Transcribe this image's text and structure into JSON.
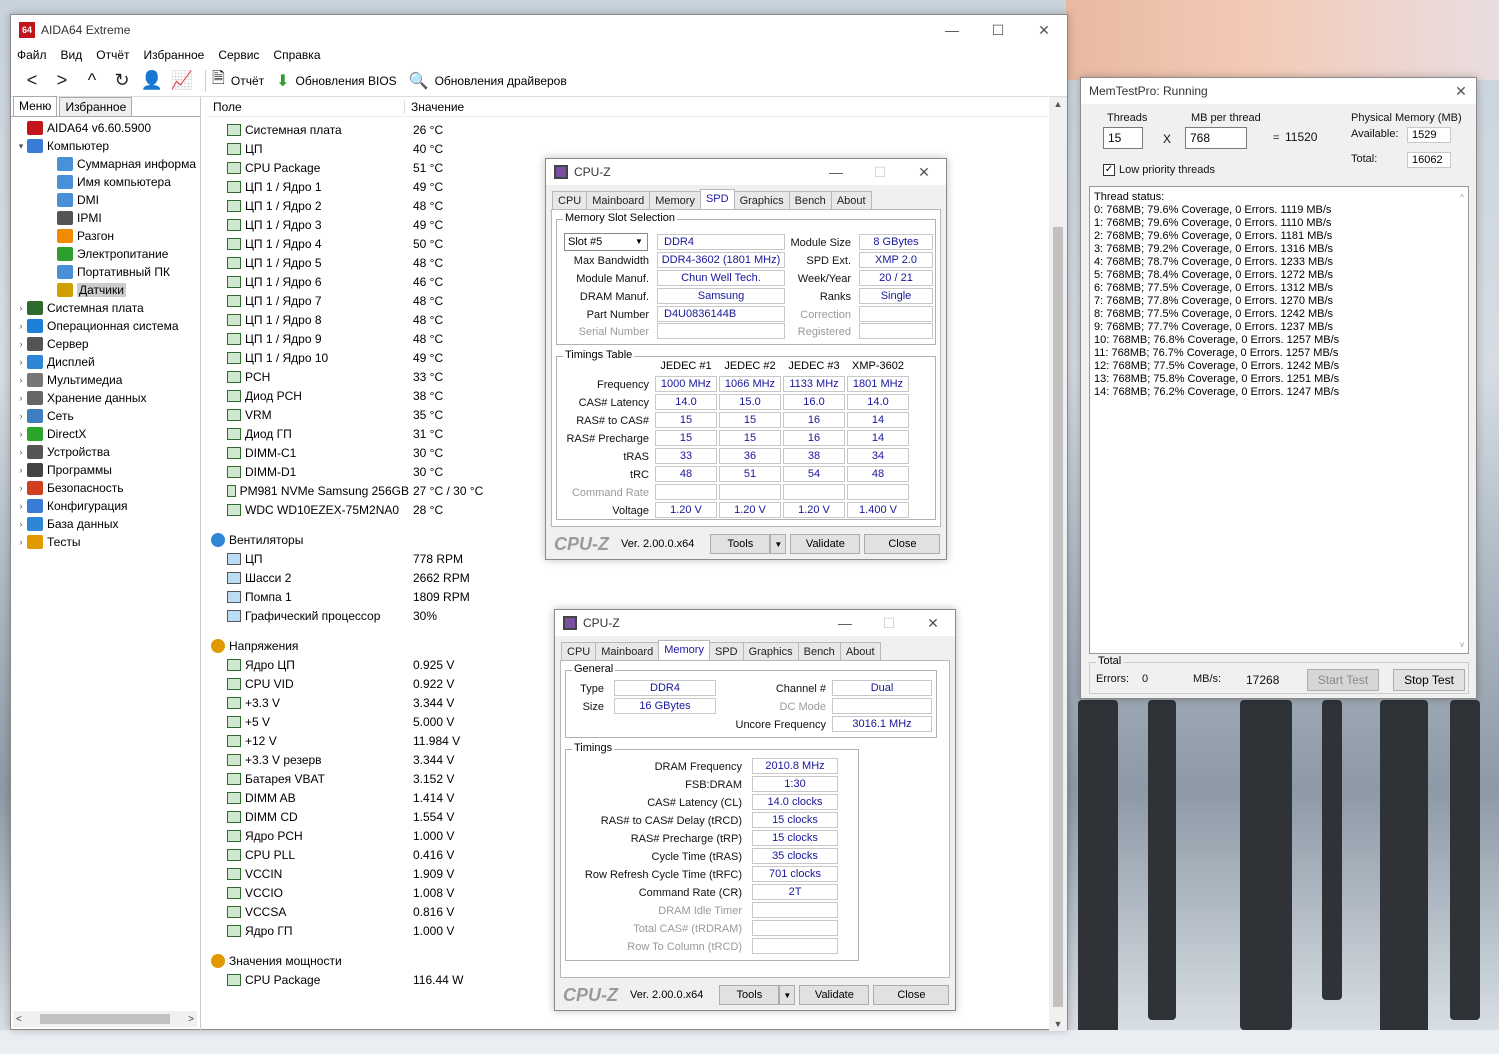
{
  "aida": {
    "title": "AIDA64 Extreme",
    "logo": "64",
    "menu": [
      "Файл",
      "Вид",
      "Отчёт",
      "Избранное",
      "Сервис",
      "Справка"
    ],
    "toolbar": {
      "report": "Отчёт",
      "bios": "Обновления BIOS",
      "drivers": "Обновления драйверов"
    },
    "tabs": [
      "Меню",
      "Избранное"
    ],
    "tree": [
      {
        "label": "AIDA64 v6.60.5900",
        "level": 0,
        "color": "#c0151b"
      },
      {
        "label": "Компьютер",
        "level": 0,
        "color": "#3a7bd5",
        "expanded": true
      },
      {
        "label": "Суммарная информа",
        "level": 1,
        "color": "#4a90d9"
      },
      {
        "label": "Имя компьютера",
        "level": 1,
        "color": "#4a90d9"
      },
      {
        "label": "DMI",
        "level": 1,
        "color": "#4a90d9"
      },
      {
        "label": "IPMI",
        "level": 1,
        "color": "#555555"
      },
      {
        "label": "Разгон",
        "level": 1,
        "color": "#f08a00"
      },
      {
        "label": "Электропитание",
        "level": 1,
        "color": "#2e9e2e"
      },
      {
        "label": "Портативный ПК",
        "level": 1,
        "color": "#4a90d9"
      },
      {
        "label": "Датчики",
        "level": 1,
        "color": "#d0a000",
        "selected": true
      },
      {
        "label": "Системная плата",
        "level": 0,
        "color": "#2f6b2f"
      },
      {
        "label": "Операционная система",
        "level": 0,
        "color": "#1e7fd6"
      },
      {
        "label": "Сервер",
        "level": 0,
        "color": "#555555"
      },
      {
        "label": "Дисплей",
        "level": 0,
        "color": "#2f86d6"
      },
      {
        "label": "Мультимедиа",
        "level": 0,
        "color": "#777777"
      },
      {
        "label": "Хранение данных",
        "level": 0,
        "color": "#666666"
      },
      {
        "label": "Сеть",
        "level": 0,
        "color": "#3f7fbf"
      },
      {
        "label": "DirectX",
        "level": 0,
        "color": "#2aa52a"
      },
      {
        "label": "Устройства",
        "level": 0,
        "color": "#555555"
      },
      {
        "label": "Программы",
        "level": 0,
        "color": "#444444"
      },
      {
        "label": "Безопасность",
        "level": 0,
        "color": "#d04020"
      },
      {
        "label": "Конфигурация",
        "level": 0,
        "color": "#3a7bd5"
      },
      {
        "label": "База данных",
        "level": 0,
        "color": "#2f86d6"
      },
      {
        "label": "Тесты",
        "level": 0,
        "color": "#e09a00"
      }
    ],
    "columns": {
      "field": "Поле",
      "value": "Значение"
    },
    "temps": [
      {
        "name": "Системная плата",
        "value": "26 °C"
      },
      {
        "name": "ЦП",
        "value": "40 °C"
      },
      {
        "name": "CPU Package",
        "value": "51 °C"
      },
      {
        "name": "ЦП 1 / Ядро 1",
        "value": "49 °C"
      },
      {
        "name": "ЦП 1 / Ядро 2",
        "value": "48 °C"
      },
      {
        "name": "ЦП 1 / Ядро 3",
        "value": "49 °C"
      },
      {
        "name": "ЦП 1 / Ядро 4",
        "value": "50 °C"
      },
      {
        "name": "ЦП 1 / Ядро 5",
        "value": "48 °C"
      },
      {
        "name": "ЦП 1 / Ядро 6",
        "value": "46 °C"
      },
      {
        "name": "ЦП 1 / Ядро 7",
        "value": "48 °C"
      },
      {
        "name": "ЦП 1 / Ядро 8",
        "value": "48 °C"
      },
      {
        "name": "ЦП 1 / Ядро 9",
        "value": "48 °C"
      },
      {
        "name": "ЦП 1 / Ядро 10",
        "value": "49 °C"
      },
      {
        "name": "PCH",
        "value": "33 °C"
      },
      {
        "name": "Диод PCH",
        "value": "38 °C"
      },
      {
        "name": "VRM",
        "value": "35 °C"
      },
      {
        "name": "Диод ГП",
        "value": "31 °C"
      },
      {
        "name": "DIMM-C1",
        "value": "30 °C"
      },
      {
        "name": "DIMM-D1",
        "value": "30 °C"
      },
      {
        "name": "PM981 NVMe Samsung 256GB",
        "value": "27 °C / 30 °C"
      },
      {
        "name": "WDC WD10EZEX-75M2NA0",
        "value": "28 °C"
      }
    ],
    "fans_title": "Вентиляторы",
    "fans": [
      {
        "name": "ЦП",
        "value": "778 RPM"
      },
      {
        "name": "Шасси 2",
        "value": "2662 RPM"
      },
      {
        "name": "Помпа 1",
        "value": "1809 RPM"
      },
      {
        "name": "Графический процессор",
        "value": "30%"
      }
    ],
    "volts_title": "Напряжения",
    "volts": [
      {
        "name": "Ядро ЦП",
        "value": "0.925 V"
      },
      {
        "name": "CPU VID",
        "value": "0.922 V"
      },
      {
        "name": "+3.3 V",
        "value": "3.344 V"
      },
      {
        "name": "+5 V",
        "value": "5.000 V"
      },
      {
        "name": "+12 V",
        "value": "11.984 V"
      },
      {
        "name": "+3.3 V резерв",
        "value": "3.344 V"
      },
      {
        "name": "Батарея VBAT",
        "value": "3.152 V"
      },
      {
        "name": "DIMM AB",
        "value": "1.414 V"
      },
      {
        "name": "DIMM CD",
        "value": "1.554 V"
      },
      {
        "name": "Ядро PCH",
        "value": "1.000 V"
      },
      {
        "name": "CPU PLL",
        "value": "0.416 V"
      },
      {
        "name": "VCCIN",
        "value": "1.909 V"
      },
      {
        "name": "VCCIO",
        "value": "1.008 V"
      },
      {
        "name": "VCCSA",
        "value": "0.816 V"
      },
      {
        "name": "Ядро ГП",
        "value": "1.000 V"
      }
    ],
    "power_title": "Значения мощности",
    "power": [
      {
        "name": "CPU Package",
        "value": "116.44 W"
      }
    ]
  },
  "cpuz_spd": {
    "title": "CPU-Z",
    "tabs": [
      "CPU",
      "Mainboard",
      "Memory",
      "SPD",
      "Graphics",
      "Bench",
      "About"
    ],
    "slot_group": "Memory Slot Selection",
    "slot": "Slot #5",
    "type": "DDR4",
    "labels": {
      "max_bw": "Max Bandwidth",
      "manuf": "Module Manuf.",
      "dram": "DRAM Manuf.",
      "part": "Part Number",
      "serial": "Serial Number",
      "size": "Module Size",
      "spd_ext": "SPD Ext.",
      "week": "Week/Year",
      "ranks": "Ranks",
      "correction": "Correction",
      "registered": "Registered"
    },
    "max_bw": "DDR4-3602 (1801 MHz)",
    "manuf": "Chun Well Tech.",
    "dram": "Samsung",
    "part": "D4U0836144B",
    "size": "8 GBytes",
    "spd_ext": "XMP 2.0",
    "week": "20 / 21",
    "ranks": "Single",
    "timings_group": "Timings Table",
    "timing_cols": [
      "JEDEC #1",
      "JEDEC #2",
      "JEDEC #3",
      "XMP-3602"
    ],
    "timing_rows": [
      {
        "label": "Frequency",
        "values": [
          "1000 MHz",
          "1066 MHz",
          "1133 MHz",
          "1801 MHz"
        ]
      },
      {
        "label": "CAS# Latency",
        "values": [
          "14.0",
          "15.0",
          "16.0",
          "14.0"
        ]
      },
      {
        "label": "RAS# to CAS#",
        "values": [
          "15",
          "15",
          "16",
          "14"
        ]
      },
      {
        "label": "RAS# Precharge",
        "values": [
          "15",
          "15",
          "16",
          "14"
        ]
      },
      {
        "label": "tRAS",
        "values": [
          "33",
          "36",
          "38",
          "34"
        ]
      },
      {
        "label": "tRC",
        "values": [
          "48",
          "51",
          "54",
          "48"
        ]
      },
      {
        "label": "Command Rate",
        "values": [
          "",
          "",
          "",
          ""
        ],
        "dim": true
      },
      {
        "label": "Voltage",
        "values": [
          "1.20 V",
          "1.20 V",
          "1.20 V",
          "1.400 V"
        ]
      }
    ],
    "brand": "CPU-Z",
    "version": "Ver. 2.00.0.x64",
    "tools": "Tools",
    "validate": "Validate",
    "close": "Close"
  },
  "cpuz_mem": {
    "title": "CPU-Z",
    "tabs": [
      "CPU",
      "Mainboard",
      "Memory",
      "SPD",
      "Graphics",
      "Bench",
      "About"
    ],
    "general_group": "General",
    "labels": {
      "type": "Type",
      "size": "Size",
      "channel": "Channel #",
      "dc": "DC Mode",
      "uncore": "Uncore Frequency"
    },
    "type": "DDR4",
    "size": "16 GBytes",
    "channel": "Dual",
    "uncore": "3016.1 MHz",
    "timings_group": "Timings",
    "timings": [
      {
        "label": "DRAM Frequency",
        "value": "2010.8 MHz"
      },
      {
        "label": "FSB:DRAM",
        "value": "1:30"
      },
      {
        "label": "CAS# Latency (CL)",
        "value": "14.0 clocks"
      },
      {
        "label": "RAS# to CAS# Delay (tRCD)",
        "value": "15 clocks"
      },
      {
        "label": "RAS# Precharge (tRP)",
        "value": "15 clocks"
      },
      {
        "label": "Cycle Time (tRAS)",
        "value": "35 clocks"
      },
      {
        "label": "Row Refresh Cycle Time (tRFC)",
        "value": "701 clocks"
      },
      {
        "label": "Command Rate (CR)",
        "value": "2T"
      },
      {
        "label": "DRAM Idle Timer",
        "value": "",
        "dim": true
      },
      {
        "label": "Total CAS# (tRDRAM)",
        "value": "",
        "dim": true
      },
      {
        "label": "Row To Column (tRCD)",
        "value": "",
        "dim": true
      }
    ],
    "brand": "CPU-Z",
    "version": "Ver. 2.00.0.x64",
    "tools": "Tools",
    "validate": "Validate",
    "close": "Close"
  },
  "mtp": {
    "title": "MemTestPro: Running",
    "threads_label": "Threads",
    "threads": "15",
    "times": "X",
    "mb_label": "MB per thread",
    "mb": "768",
    "equals": "=",
    "total_mb": "11520",
    "phys_label": "Physical Memory (MB)",
    "available_label": "Available:",
    "available": "1529",
    "total_label": "Total:",
    "total": "16062",
    "low_priority": "Low priority threads",
    "status_title": "Thread status:",
    "status_lines": [
      "0: 768MB;  79.6% Coverage, 0 Errors. 1119 MB/s",
      "1: 768MB;  79.6% Coverage, 0 Errors. 1110 MB/s",
      "2: 768MB;  79.6% Coverage, 0 Errors. 1181 MB/s",
      "3: 768MB;  79.2% Coverage, 0 Errors. 1316 MB/s",
      "4: 768MB;  78.7% Coverage, 0 Errors. 1233 MB/s",
      "5: 768MB;  78.4% Coverage, 0 Errors. 1272 MB/s",
      "6: 768MB;  77.5% Coverage, 0 Errors. 1312 MB/s",
      "7: 768MB;  77.8% Coverage, 0 Errors. 1270 MB/s",
      "8: 768MB;  77.5% Coverage, 0 Errors. 1242 MB/s",
      "9: 768MB;  77.7% Coverage, 0 Errors. 1237 MB/s",
      "10: 768MB;  76.8% Coverage, 0 Errors. 1257 MB/s",
      "11: 768MB;  76.7% Coverage, 0 Errors. 1257 MB/s",
      "12: 768MB;  77.5% Coverage, 0 Errors. 1242 MB/s",
      "13: 768MB;  75.8% Coverage, 0 Errors. 1251 MB/s",
      "14: 768MB;  76.2% Coverage, 0 Errors. 1247 MB/s"
    ],
    "total_group": "Total",
    "errors_label": "Errors:",
    "errors": "0",
    "mbs_label": "MB/s:",
    "mbs": "17268",
    "start": "Start Test",
    "stop": "Stop Test"
  }
}
